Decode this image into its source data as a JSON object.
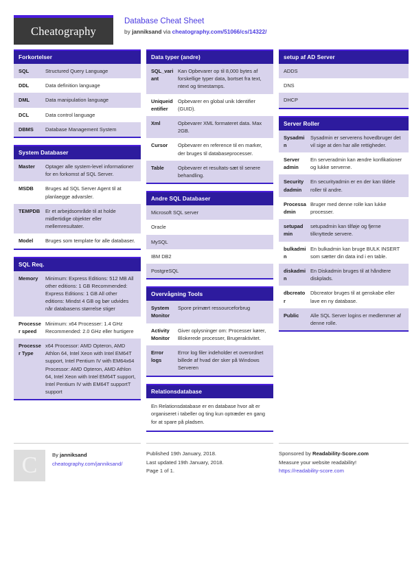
{
  "masthead": {
    "logo": "Cheatography",
    "title": "Database Cheat Sheet",
    "by_prefix": "by ",
    "author": "janniksand",
    "via": " via ",
    "source_url": "cheatography.com/51066/cs/14322/"
  },
  "colors": {
    "header_bg": "#2d1b9e",
    "accent": "#4a1ddd",
    "row_alt": "#d8d3ec",
    "link": "#4a3ae0"
  },
  "columns": [
    {
      "cards": [
        {
          "title": "Forkortelser",
          "rows": [
            {
              "k": "SQL",
              "v": "Structured Query Language"
            },
            {
              "k": "DDL",
              "v": "Data definition language"
            },
            {
              "k": "DML",
              "v": "Data manipulation language"
            },
            {
              "k": "DCL",
              "v": "Data control language"
            },
            {
              "k": "DBMS",
              "v": "Database Management System"
            }
          ]
        },
        {
          "title": "System Databaser",
          "rows": [
            {
              "k": "Master",
              "v": "Optager alle system-level informationer for en forkomst af SQL Server."
            },
            {
              "k": "MSDB",
              "v": "Bruges ad SQL Server Agent til at planlaegge advarsler."
            },
            {
              "k": "TEMPDB",
              "v": "Er et arbejdsområde til at holde midlertidige objekter eller mellemresultater."
            },
            {
              "k": "Model",
              "v": "Bruges som template for alle databaser."
            }
          ]
        },
        {
          "title": "SQL Req.",
          "rows": [
            {
              "k": "Memory",
              "v": "Minimum: Express Editions: 512 MB All other editions: 1 GB Recommended: Express Editions: 1 GB All other editions: Mindst 4 GB og bør udvides når databasens størrelse stiger"
            },
            {
              "k": "Processer speed",
              "v": "Minimum: x64 Processer: 1.4 GHz Recommended: 2.0 GHz eller hurtigere"
            },
            {
              "k": "Processer Type",
              "v": "x64 Processor: AMD Opteron, AMD Athlon 64, Intel Xeon with Intel EM64T support, Intel Pentium IV with EM64x64 Processor: AMD Opteron, AMD Athlon 64, Intel Xeon with Intel EM64T support, Intel Pentium IV with EM64T supportT support"
            }
          ]
        }
      ]
    },
    {
      "cards": [
        {
          "title": "Data typer (andre)",
          "rows": [
            {
              "k": "SQL_variant",
              "v": "Kan Opbevarer op til 8,000 bytes af forskellige typer data, bortset fra text, ntext og timestamps."
            },
            {
              "k": "Uniqueidentifier",
              "v": "Opbevarer en global unik Identifier (GUID)."
            },
            {
              "k": "Xml",
              "v": "Opbevarer XML formateret data. Max 2GB."
            },
            {
              "k": "Cursor",
              "v": "Opbevarer en reference til en marker, der bruges til databaseprocesser."
            },
            {
              "k": "Table",
              "v": "Opbevarer et resultats-sæt til senere behandling."
            }
          ]
        },
        {
          "title": "Andre SQL Databaser",
          "list": [
            "Microsoft SQL server",
            "Oracle",
            "MySQL",
            "IBM DB2",
            "PostgreSQL"
          ]
        },
        {
          "title": "Overvågning Tools",
          "rows": [
            {
              "k": "System Monitor",
              "v": "Spore primært ressourceforbrug"
            },
            {
              "k": "Activity Monitor",
              "v": "Giver oplysninger om: Processer kører, Blokerede processer, Brugeraktivitet."
            },
            {
              "k": "Error logs",
              "v": "Error log filer indeholder et overordnet billede af hvad der sker på Windows Serveren"
            }
          ]
        },
        {
          "title": "Relationsdatabase",
          "paragraph": "En Relationsdatabase er en database hvor alt er organiseret i tabeller og ting kun optræder en gang for at spare på pladsen."
        }
      ]
    },
    {
      "cards": [
        {
          "title": "setup af AD Server",
          "list": [
            "ADDS",
            "DNS",
            "DHCP"
          ]
        },
        {
          "title": "Server Roller",
          "rows": [
            {
              "k": "Sysadmin",
              "v": "Sysadmin er serverens hovedbruger det vil sige at den har alle rettigheder."
            },
            {
              "k": "Server admin",
              "v": "En serveradmin kan ændre konfikationer og lukke serverne."
            },
            {
              "k": "Securitydadmin",
              "v": "En securityadmin er en der kan tildele roller til andre."
            },
            {
              "k": "Processadmin",
              "v": "Bruger med denne rolle kan lukke processer."
            },
            {
              "k": "setupadmin",
              "v": "setupadmin kan tilføje og fjerne tilknyttede servere."
            },
            {
              "k": "bulkadmin",
              "v": "En bulkadmin kan bruge BULK INSERT som sætter din data ind i en table."
            },
            {
              "k": "diskadmin",
              "v": "En Diskadmin bruges til at håndtere diskplads."
            },
            {
              "k": "dbcreator",
              "v": "Dbcreator bruges til at genskabe eller lave en ny database."
            },
            {
              "k": "Public",
              "v": "Alle SQL Server logins er medlemmer af denne rolle."
            }
          ]
        }
      ]
    }
  ],
  "footer": {
    "avatar_letter": "C",
    "by_label": "By ",
    "author": "janniksand",
    "author_url": "cheatography.com/janniksand/",
    "published": "Published 19th January, 2018.",
    "updated": "Last updated 19th January, 2018.",
    "page": "Page 1 of 1.",
    "sponsor_prefix": "Sponsored by ",
    "sponsor": "Readability-Score.com",
    "sponsor_tagline": "Measure your website readability!",
    "sponsor_url": "https://readability-score.com"
  }
}
